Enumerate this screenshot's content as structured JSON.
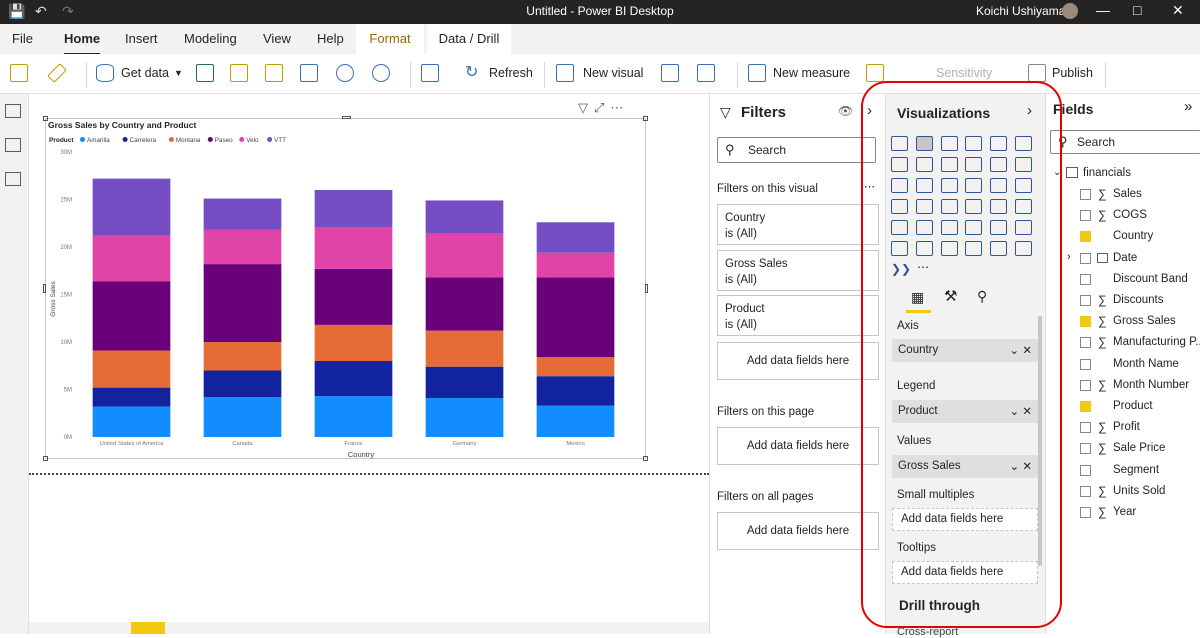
{
  "window": {
    "title": "Untitled - Power BI Desktop",
    "user": "Koichi Ushiyama"
  },
  "tabs": [
    "File",
    "Home",
    "Insert",
    "Modeling",
    "View",
    "Help"
  ],
  "context_tabs": [
    "Format",
    "Data / Drill"
  ],
  "ribbon": {
    "get_data": "Get data",
    "refresh": "Refresh",
    "new_visual": "New visual",
    "new_measure": "New measure",
    "sensitivity": "Sensitivity",
    "publish": "Publish"
  },
  "filters": {
    "title": "Filters",
    "search_placeholder": "Search",
    "on_visual": "Filters on this visual",
    "on_page": "Filters on this page",
    "on_all": "Filters on all pages",
    "cards": [
      {
        "name": "Country",
        "state": "is (All)"
      },
      {
        "name": "Gross Sales",
        "state": "is (All)"
      },
      {
        "name": "Product",
        "state": "is (All)"
      }
    ],
    "add": "Add data fields here"
  },
  "visualizations": {
    "title": "Visualizations",
    "wells": {
      "axis": "Axis",
      "legend": "Legend",
      "values": "Values",
      "small_multiples": "Small multiples",
      "tooltips": "Tooltips"
    },
    "axis_value": "Country",
    "legend_value": "Product",
    "values_value": "Gross Sales",
    "add": "Add data fields here",
    "drill_through": "Drill through",
    "cross_report": "Cross-report"
  },
  "fields": {
    "title": "Fields",
    "search_placeholder": "Search",
    "table": "financials",
    "items": [
      {
        "name": "Sales",
        "sigma": true,
        "checked": false
      },
      {
        "name": "COGS",
        "sigma": true,
        "checked": false
      },
      {
        "name": "Country",
        "sigma": false,
        "checked": true
      },
      {
        "name": "Date",
        "sigma": false,
        "checked": false
      },
      {
        "name": "Discount Band",
        "sigma": false,
        "checked": false
      },
      {
        "name": "Discounts",
        "sigma": true,
        "checked": false
      },
      {
        "name": "Gross Sales",
        "sigma": true,
        "checked": true
      },
      {
        "name": "Manufacturing P...",
        "sigma": true,
        "checked": false
      },
      {
        "name": "Month Name",
        "sigma": false,
        "checked": false
      },
      {
        "name": "Month Number",
        "sigma": true,
        "checked": false
      },
      {
        "name": "Product",
        "sigma": false,
        "checked": true
      },
      {
        "name": "Profit",
        "sigma": true,
        "checked": false
      },
      {
        "name": "Sale Price",
        "sigma": true,
        "checked": false
      },
      {
        "name": "Segment",
        "sigma": false,
        "checked": false
      },
      {
        "name": "Units Sold",
        "sigma": true,
        "checked": false
      },
      {
        "name": "Year",
        "sigma": true,
        "checked": false
      }
    ]
  },
  "chart_data": {
    "type": "bar",
    "stacked": true,
    "title": "Gross Sales by Country and Product",
    "legend_title": "Product",
    "xlabel": "Country",
    "ylabel": "Gross Sales",
    "ylim": [
      0,
      30
    ],
    "yticks": [
      "0M",
      "5M",
      "10M",
      "15M",
      "20M",
      "25M",
      "30M"
    ],
    "categories": [
      "United States of America",
      "Canada",
      "France",
      "Germany",
      "Mexico"
    ],
    "series": [
      {
        "name": "Amarilla",
        "color": "#118dff",
        "values": [
          3.2,
          4.2,
          4.3,
          4.1,
          3.3
        ]
      },
      {
        "name": "Carretera",
        "color": "#12239e",
        "values": [
          2.0,
          2.8,
          3.7,
          3.3,
          3.1
        ]
      },
      {
        "name": "Montana",
        "color": "#e66c37",
        "values": [
          3.9,
          3.0,
          3.8,
          3.8,
          2.0
        ]
      },
      {
        "name": "Paseo",
        "color": "#6b007b",
        "values": [
          7.3,
          8.2,
          5.9,
          5.6,
          8.4
        ]
      },
      {
        "name": "Velo",
        "color": "#e044a7",
        "values": [
          4.8,
          3.6,
          4.4,
          4.6,
          2.6
        ]
      },
      {
        "name": "VTT",
        "color": "#744ec2",
        "values": [
          6.0,
          3.3,
          3.9,
          3.5,
          3.2
        ]
      }
    ]
  }
}
